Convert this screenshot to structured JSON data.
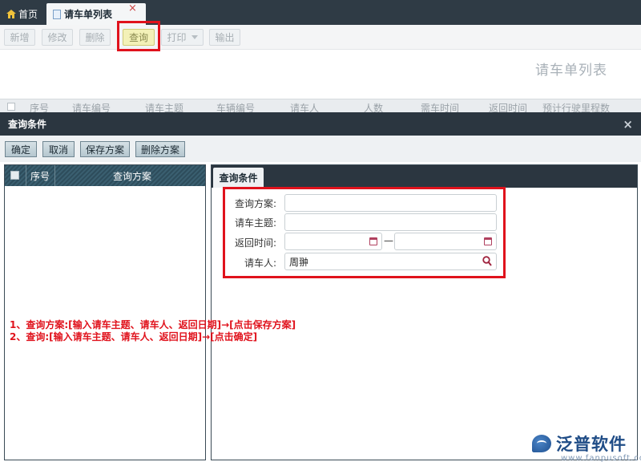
{
  "tabs": {
    "home_label": "首页",
    "active_label": "请车单列表",
    "close_glyph": "×"
  },
  "toolbar": {
    "new_label": "新增",
    "edit_label": "修改",
    "delete_label": "删除",
    "query_label": "查询",
    "print_label": "打印",
    "export_label": "输出"
  },
  "page_title": "请车单列表",
  "grid_columns": [
    "序号",
    "请车编号",
    "请车主题",
    "车辆编号",
    "请车人",
    "人数",
    "需车时间",
    "返回时间",
    "预计行驶里程数"
  ],
  "dialog": {
    "title": "查询条件",
    "close_glyph": "×",
    "buttons": {
      "confirm": "确定",
      "cancel": "取消",
      "save_scheme": "保存方案",
      "delete_scheme": "删除方案"
    },
    "list_headers": {
      "seq": "序号",
      "scheme": "查询方案"
    },
    "condition_tab": "查询条件",
    "fields": {
      "scheme_label": "查询方案:",
      "scheme_value": "",
      "subject_label": "请车主题:",
      "subject_value": "",
      "return_label": "返回时间:",
      "return_from": "",
      "return_to": "",
      "range_sep": "—",
      "requester_label": "请车人:",
      "requester_value": "周翀"
    }
  },
  "notes": [
    "1、查询方案:[输入请车主题、请车人、返回日期]→[点击保存方案]",
    "2、查询:[输入请车主题、请车人、返回日期]→[点击确定]"
  ],
  "logo": {
    "text": "泛普软件",
    "url": "www.fanpusoft.com"
  },
  "colors": {
    "highlight_red": "#e0121c",
    "dark_bar": "#2b3640",
    "logo_blue": "#1f4c86"
  }
}
